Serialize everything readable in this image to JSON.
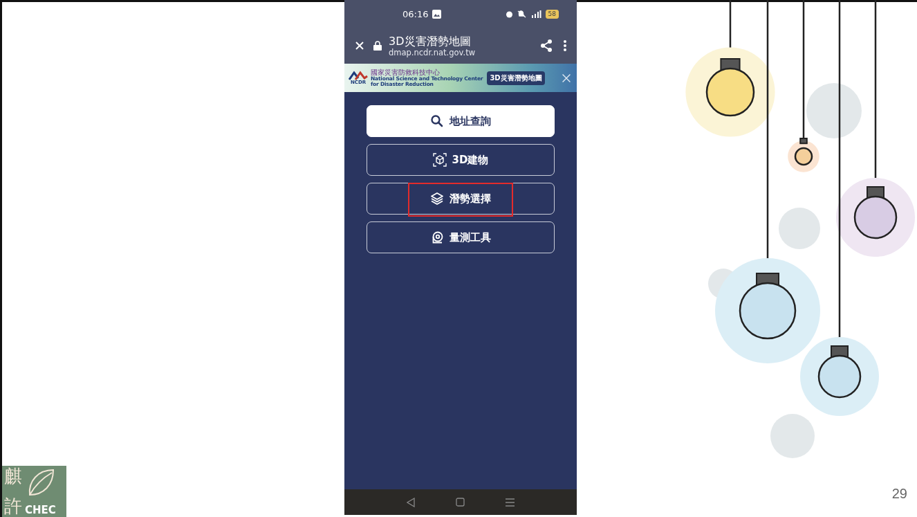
{
  "status_bar": {
    "time": "06:16",
    "battery": "58"
  },
  "browser_bar": {
    "title": "3D災害潛勢地圖",
    "url": "dmap.ncdr.nat.gov.tw"
  },
  "banner": {
    "logo_text": "NCDR",
    "org_name": "國家災害防救科技中心",
    "org_name_en_1": "National Science and Technology Center",
    "org_name_en_2": "for Disaster Reduction",
    "app_chip": "3D災害潛勢地圖"
  },
  "menu": [
    {
      "label": "地址查詢",
      "kind": "filled",
      "highlighted": false
    },
    {
      "label": "3D建物",
      "kind": "outline",
      "highlighted": false
    },
    {
      "label": "潛勢選擇",
      "kind": "outline",
      "highlighted": true
    },
    {
      "label": "量測工具",
      "kind": "outline",
      "highlighted": false
    }
  ],
  "slide_logo": {
    "char_1": "麒",
    "char_2": "許",
    "wordmark": "CHEC"
  },
  "page_number": "29"
}
